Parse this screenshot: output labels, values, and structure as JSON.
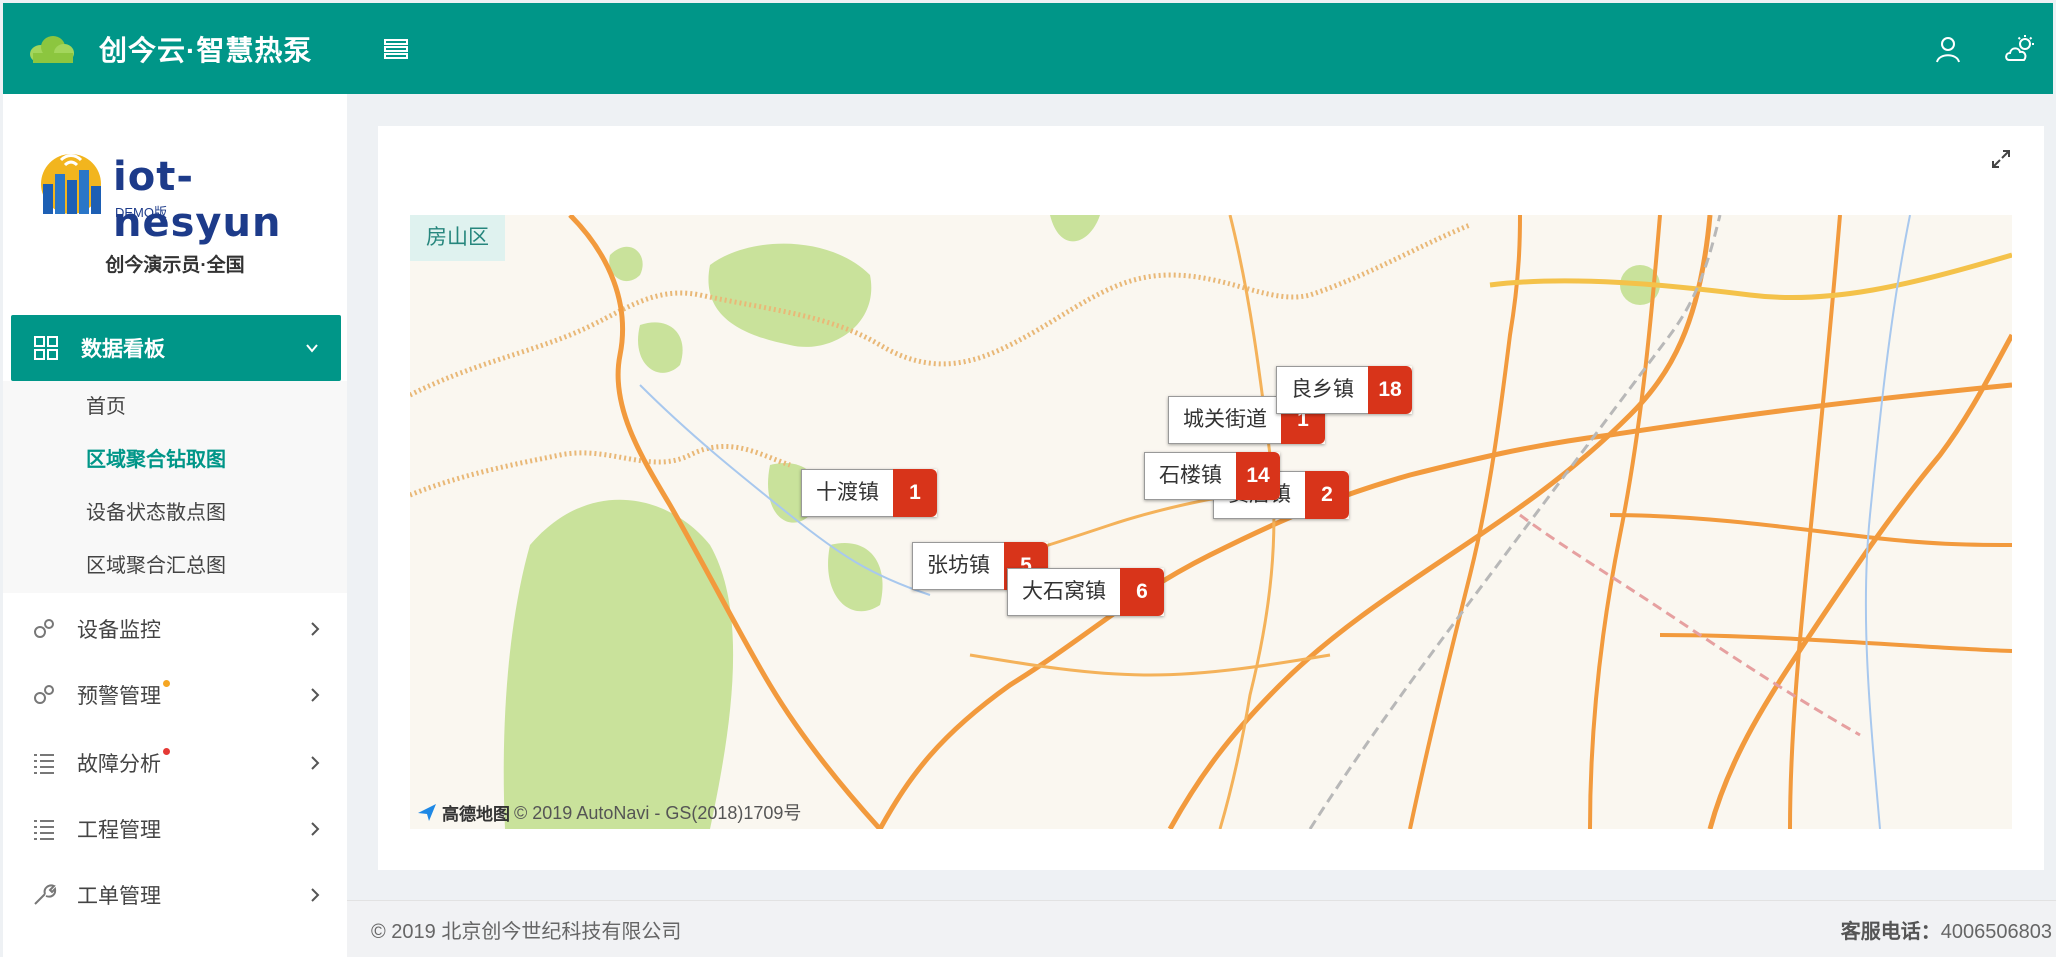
{
  "header": {
    "title": "创今云·智慧热泵",
    "colors": {
      "primary": "#009688"
    },
    "icons": {
      "logo": "cloud-icon",
      "menu": "menu-toggle-icon",
      "user": "user-icon",
      "theme": "weather-icon"
    }
  },
  "sidebar": {
    "logo_text": "iot-nesyun",
    "logo_sub": "DEMO版",
    "user_name": "创今演示员·全国",
    "active_group": {
      "label": "数据看板",
      "icon": "grid-icon"
    },
    "sub_items": [
      {
        "label": "首页"
      },
      {
        "label": "区域聚合钻取图",
        "active": true
      },
      {
        "label": "设备状态散点图"
      },
      {
        "label": "区域聚合汇总图"
      }
    ],
    "items": [
      {
        "label": "设备监控",
        "icon": "gears-icon",
        "dot": null
      },
      {
        "label": "预警管理",
        "icon": "gears-icon",
        "dot": "#f5a623"
      },
      {
        "label": "故障分析",
        "icon": "checklist-icon",
        "dot": "#e53935"
      },
      {
        "label": "工程管理",
        "icon": "checklist-icon",
        "dot": null
      },
      {
        "label": "工单管理",
        "icon": "wrench-icon",
        "dot": null
      }
    ]
  },
  "map": {
    "region": "房山区",
    "markers": [
      {
        "name": "十渡镇",
        "count": "1"
      },
      {
        "name": "张坊镇",
        "count": "5"
      },
      {
        "name": "大石窝镇",
        "count": "6"
      },
      {
        "name": "窦店镇",
        "count": "2"
      },
      {
        "name": "石楼镇",
        "count": "14"
      },
      {
        "name": "城关街道",
        "count": "1"
      },
      {
        "name": "良乡镇",
        "count": "18"
      }
    ],
    "attribution_logo": "高德地图",
    "attribution": "© 2019 AutoNavi - GS(2018)1709号",
    "colors": {
      "marker": "#d8341a",
      "region_tag": "#dff2ef"
    }
  },
  "footer": {
    "copyright": "© 2019 北京创今世纪科技有限公司",
    "phone_label": "客服电话：",
    "phone": "4006506803"
  }
}
